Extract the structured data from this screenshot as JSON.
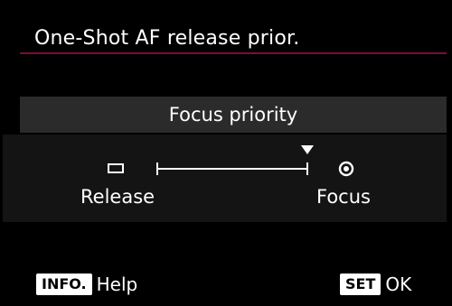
{
  "menu": {
    "title": "One-Shot AF release prior.",
    "current_value": "Focus priority"
  },
  "slider": {
    "left_label": "Release",
    "right_label": "Focus",
    "left_icon": "release-rectangle-icon",
    "right_icon": "focus-circle-icon",
    "level_fraction": 1.0
  },
  "footer": {
    "info_badge": "INFO.",
    "info_label": "Help",
    "set_badge": "SET",
    "set_label": "OK"
  },
  "colors": {
    "background": "#000000",
    "title_rule": "#7a0d3a",
    "value_box": "#2b2b2b",
    "slider_band": "#141414",
    "text": "#ffffff"
  }
}
